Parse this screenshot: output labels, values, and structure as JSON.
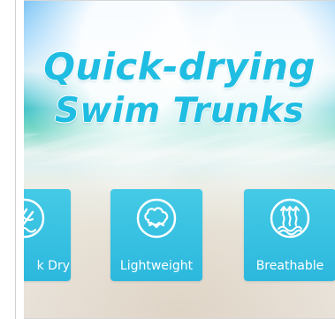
{
  "banner": {
    "title_line_1": "Quick-drying",
    "title_line_2": "Swim Trunks",
    "title_color": "#20bde2",
    "tile_color": "#35c1e1"
  },
  "features": [
    {
      "label": "k Dry",
      "icon": "drying-cloth-icon"
    },
    {
      "label": "Lightweight",
      "icon": "cotton-icon"
    },
    {
      "label": "Breathable",
      "icon": "breathable-wave-icon"
    }
  ]
}
